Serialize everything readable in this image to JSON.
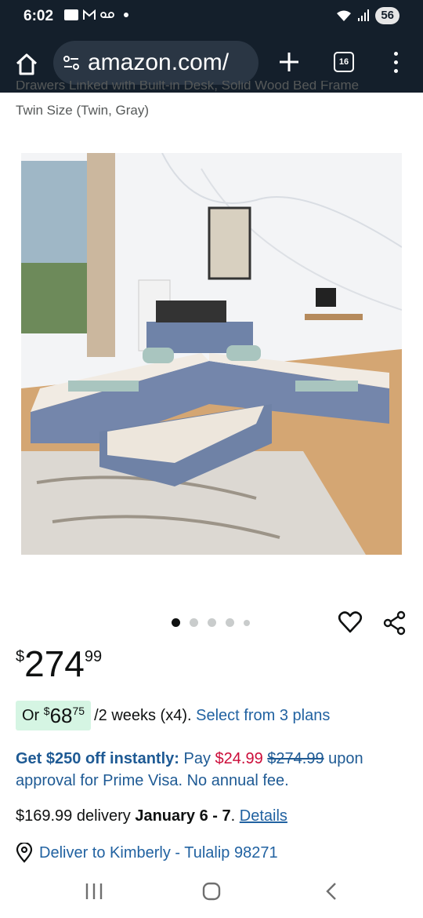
{
  "status_bar": {
    "time": "6:02",
    "battery": "56",
    "left_icons": [
      "home-icon",
      "gmail-icon",
      "voicemail-icon",
      "dot-icon"
    ],
    "right_icons": [
      "wifi-icon",
      "signal-icon",
      "battery-icon"
    ]
  },
  "browser": {
    "url": "amazon.com/",
    "tab_count": "16",
    "colors": {
      "bar": "#141f2b",
      "pill": "#2a3644"
    }
  },
  "product": {
    "title_partial": "Drawers Linked with Built-in Desk, Solid Wood Bed Frame",
    "title_variant": "Twin Size (Twin, Gray)",
    "image_alt": "L-shaped gray upholstered twin beds with trundle and storage desk",
    "carousel": {
      "count": 5,
      "active": 1
    }
  },
  "price": {
    "symbol": "$",
    "whole": "274",
    "fraction": "99"
  },
  "installment": {
    "prefix": "Or",
    "symbol": "$",
    "whole": "68",
    "fraction": "75",
    "period": "/2 weeks (x4).",
    "link": "Select from 3 plans",
    "badge_color": "#d5f5e3"
  },
  "promo": {
    "strong": "Get $250 off instantly:",
    "pay": "Pay",
    "new_price": "$24.99",
    "old_price": "$274.99",
    "upon": "upon",
    "rest": "approval for Prime Visa. No annual fee.",
    "colors": {
      "text": "#1e5a94",
      "price": "#cc0c39"
    }
  },
  "delivery": {
    "cost": "$169.99 delivery",
    "dates": "January 6 - 7",
    "dot": ".",
    "link": "Details"
  },
  "deliver_to": {
    "text": "Deliver to Kimberly - Tulalip 98271"
  },
  "nav": {
    "buttons": [
      "recent-apps-icon",
      "home-circle-icon",
      "back-icon"
    ]
  }
}
